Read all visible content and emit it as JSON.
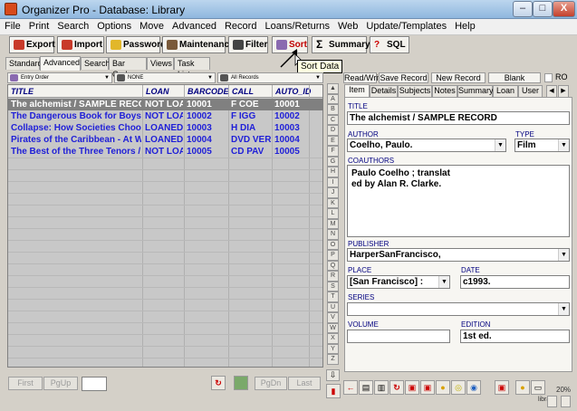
{
  "window": {
    "title": "Organizer Pro - Database: Library",
    "minimize": "–",
    "maximize": "□",
    "close": "X"
  },
  "menu": [
    "File",
    "Print",
    "Search",
    "Options",
    "Move",
    "Advanced",
    "Record",
    "Loans/Returns",
    "Web",
    "Update/Templates",
    "Help"
  ],
  "toolbar": {
    "export": "Export",
    "import": "Import",
    "password": "Password",
    "maintenance": "Maintenance",
    "filter": "Filter",
    "sort": "Sort",
    "summary": "Summary",
    "sql": "SQL"
  },
  "tooltip": "Sort Data",
  "left_tabs": [
    "Standard",
    "Advanced",
    "Search",
    "Bar Code",
    "Views",
    "Task List"
  ],
  "filters": {
    "order": "Entry Order",
    "filter": "NONE",
    "records": "All Records"
  },
  "grid": {
    "columns": [
      "TITLE",
      "LOAN",
      "BARCODE",
      "CALL",
      "AUTO_ID"
    ],
    "rows": [
      {
        "title": "The alchemist / SAMPLE RECORD",
        "loan": "NOT LOANED",
        "barcode": "10001",
        "call": "F COE",
        "auto_id": "10001"
      },
      {
        "title": "The Dangerous Book for Boys / S",
        "loan": "NOT LOANED",
        "barcode": "10002",
        "call": "F IGG",
        "auto_id": "10002"
      },
      {
        "title": "Collapse: How Societies Choose",
        "loan": "LOANED OUT",
        "barcode": "10003",
        "call": "H DIA",
        "auto_id": "10003"
      },
      {
        "title": "Pirates of the Caribbean - At Wo",
        "loan": "LOANED OUT",
        "barcode": "10004",
        "call": "DVD VER",
        "auto_id": "10004"
      },
      {
        "title": "The Best of the Three Tenors / S",
        "loan": "NOT LOANED",
        "barcode": "10005",
        "call": "CD PAV",
        "auto_id": "10005"
      }
    ]
  },
  "letters": [
    "A",
    "B",
    "C",
    "D",
    "E",
    "F",
    "G",
    "H",
    "I",
    "J",
    "K",
    "L",
    "M",
    "N",
    "O",
    "P",
    "Q",
    "R",
    "S",
    "T",
    "U",
    "V",
    "W",
    "X",
    "Y",
    "Z"
  ],
  "nav": {
    "first": "First",
    "pgup": "PgUp",
    "pgdn": "PgDn",
    "last": "Last"
  },
  "right_buttons": {
    "readwrite": "Read/Write",
    "save": "Save Record",
    "new": "New Record",
    "blank": "Blank",
    "ro": "RO"
  },
  "right_tabs": [
    "Item",
    "Details",
    "Subjects",
    "Notes",
    "Summary",
    "Loan",
    "User"
  ],
  "record": {
    "title_label": "TITLE",
    "title": "The alchemist / SAMPLE RECORD",
    "author_label": "AUTHOR",
    "author": "Coelho, Paulo.",
    "type_label": "TYPE",
    "type": "Film",
    "coauthors_label": "COAUTHORS",
    "coauthors_line1": "Paulo Coelho ; translat",
    "coauthors_line2": "ed by Alan R. Clarke.",
    "publisher_label": "PUBLISHER",
    "publisher": "HarperSanFrancisco,",
    "place_label": "PLACE",
    "place": "[San Francisco] :",
    "date_label": "DATE",
    "date": "c1993.",
    "series_label": "SERIES",
    "series": "",
    "volume_label": "VOLUME",
    "volume": "",
    "edition_label": "EDITION",
    "edition": "1st ed."
  },
  "status": {
    "zoom": "20%",
    "libra": "libra"
  },
  "colors": {
    "accent_sort": "#c00000",
    "row_text": "#1f1fd8",
    "header_text": "#000080",
    "selected_row": "#808080"
  }
}
